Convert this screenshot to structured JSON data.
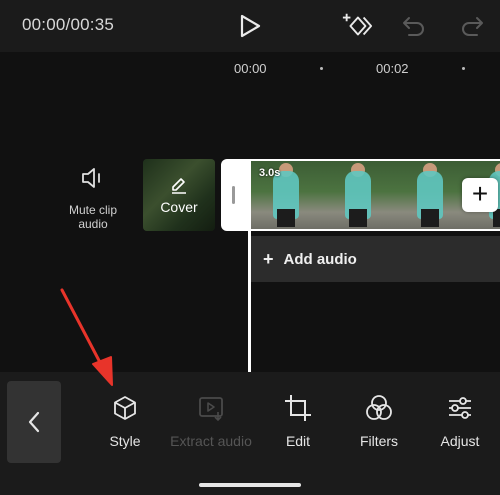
{
  "player": {
    "time": "00:00/00:35",
    "icons": [
      "play-icon",
      "keyframe-add-icon",
      "undo-icon",
      "redo-icon"
    ]
  },
  "ruler": {
    "labels": [
      "00:00",
      "00:02"
    ]
  },
  "timeline": {
    "mute_label": "Mute clip audio",
    "cover_label": "Cover",
    "clip_duration": "3.0s",
    "add_audio_label": "Add audio",
    "add_clip_symbol": "+"
  },
  "toolbar": {
    "items": [
      {
        "label": "Style",
        "icon": "cube-icon",
        "enabled": true
      },
      {
        "label": "Extract audio",
        "icon": "extract-audio-icon",
        "enabled": false
      },
      {
        "label": "Edit",
        "icon": "crop-icon",
        "enabled": true
      },
      {
        "label": "Filters",
        "icon": "filters-icon",
        "enabled": true
      },
      {
        "label": "Adjust",
        "icon": "sliders-icon",
        "enabled": true
      }
    ]
  },
  "colors": {
    "background": "#000000",
    "panel": "#1b1b1b",
    "annotation_arrow": "#e8342a",
    "disabled_text": "#555555"
  }
}
